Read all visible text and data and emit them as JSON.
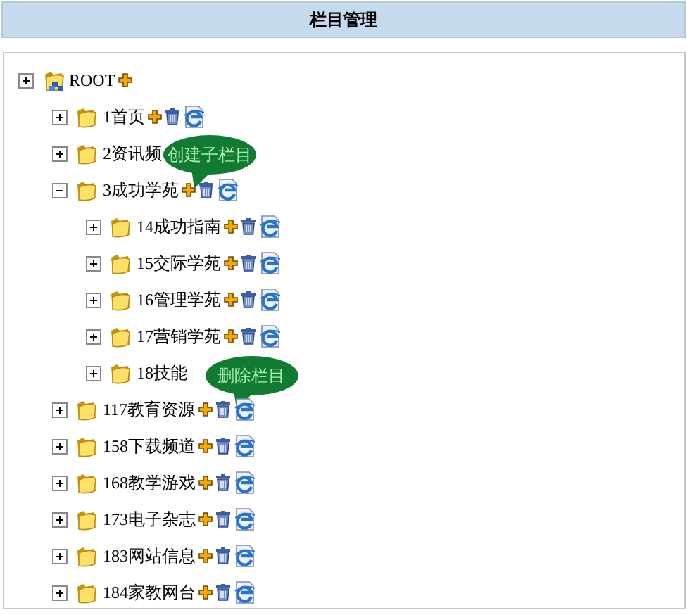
{
  "header": {
    "title": "栏目管理"
  },
  "tree": [
    {
      "label": "ROOT",
      "kind": "root",
      "expanded": false,
      "children": [
        {
          "label": "1首页",
          "kind": "folder",
          "expanded": false
        },
        {
          "label": "2资讯频",
          "kind": "folder",
          "expanded": false,
          "actions_covered": true
        },
        {
          "label": "3成功学苑",
          "kind": "folder",
          "expanded": true,
          "add_tooltip": "创建子栏目",
          "children": [
            {
              "label": "14成功指南",
              "kind": "folder",
              "expanded": false
            },
            {
              "label": "15交际学苑",
              "kind": "folder",
              "expanded": false
            },
            {
              "label": "16管理学苑",
              "kind": "folder",
              "expanded": false
            },
            {
              "label": "17营销学苑",
              "kind": "folder",
              "expanded": false
            },
            {
              "label": "18技能",
              "kind": "folder",
              "expanded": false,
              "actions_covered": true
            }
          ]
        },
        {
          "label": "117教育资源",
          "kind": "folder",
          "expanded": false,
          "delete_tooltip": "删除栏目"
        },
        {
          "label": "158下载频道",
          "kind": "folder",
          "expanded": false
        },
        {
          "label": "168教学游戏",
          "kind": "folder",
          "expanded": false
        },
        {
          "label": "173电子杂志",
          "kind": "folder",
          "expanded": false
        },
        {
          "label": "183网站信息",
          "kind": "folder",
          "expanded": false
        },
        {
          "label": "184家教网台",
          "kind": "folder",
          "expanded": false
        }
      ]
    }
  ]
}
